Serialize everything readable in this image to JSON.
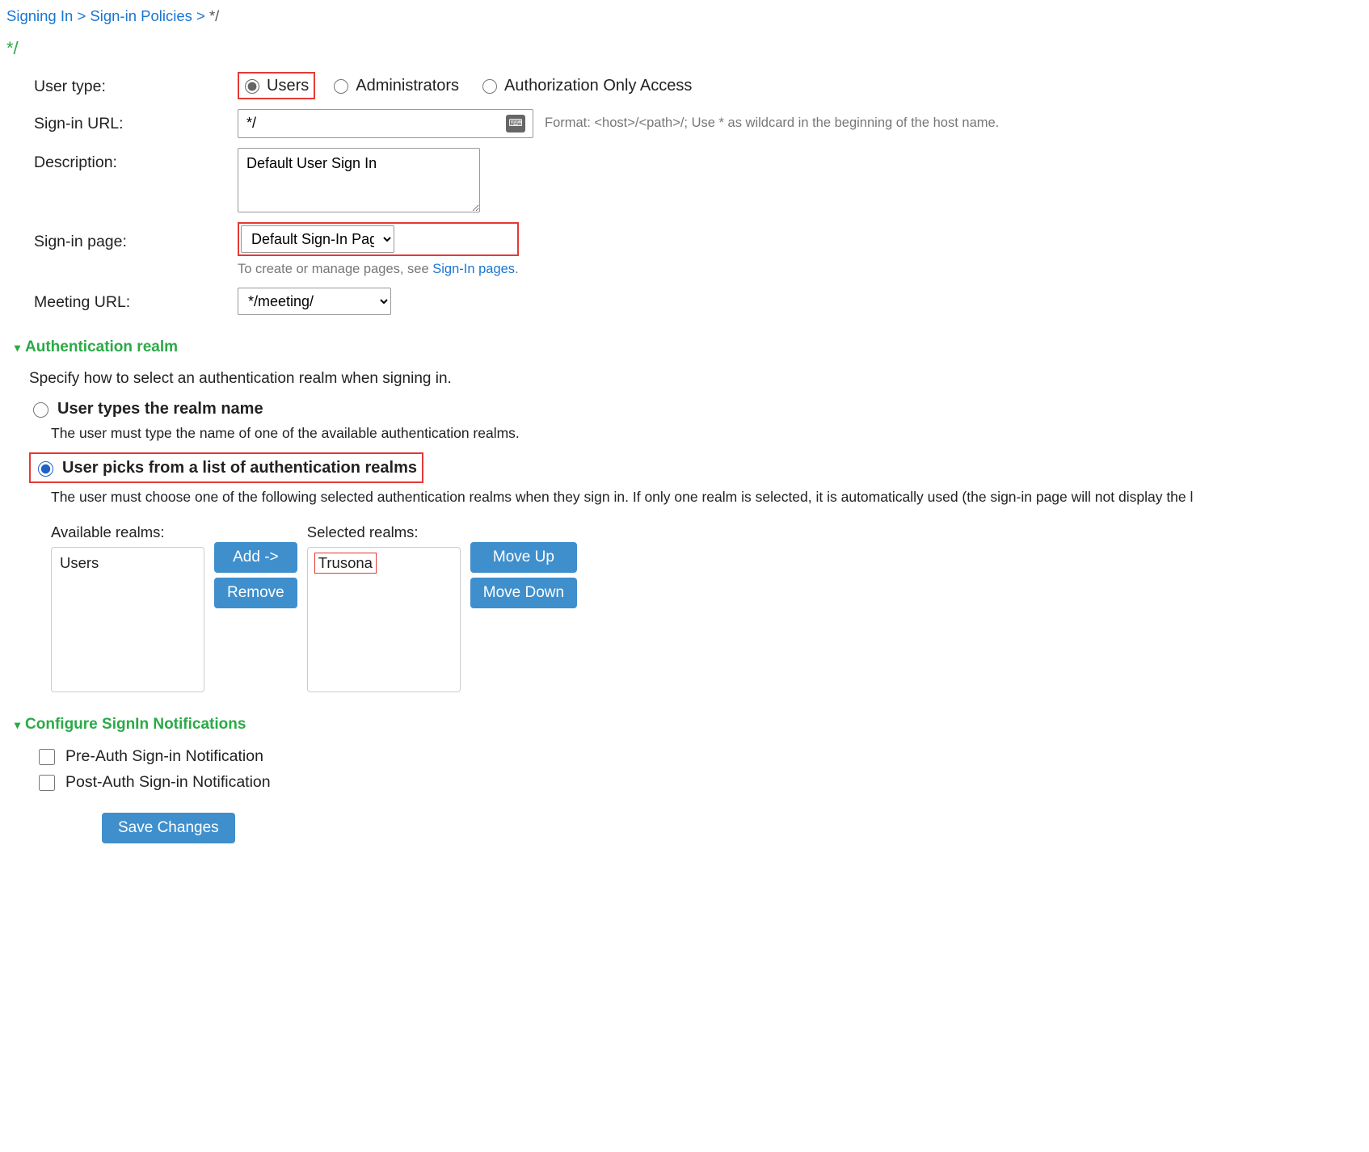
{
  "breadcrumb": {
    "items": [
      "Signing In",
      "Sign-in Policies"
    ],
    "leaf": "*/"
  },
  "title": "*/",
  "form": {
    "user_type_label": "User type:",
    "user_type_options": {
      "users": "Users",
      "administrators": "Administrators",
      "auth_only": "Authorization Only Access"
    },
    "sign_in_url_label": "Sign-in URL:",
    "sign_in_url_value": "*/",
    "sign_in_url_format": "Format: <host>/<path>/;   Use * as wildcard in the beginning of the host name.",
    "description_label": "Description:",
    "description_value": "Default User Sign In",
    "sign_in_page_label": "Sign-in page:",
    "sign_in_page_value": "Default Sign-In Page",
    "sign_in_page_hint_prefix": "To create or manage pages, see ",
    "sign_in_page_hint_link": "Sign-In pages",
    "sign_in_page_hint_suffix": ".",
    "meeting_url_label": "Meeting URL:",
    "meeting_url_value": "*/meeting/"
  },
  "section_auth": {
    "header": "Authentication realm",
    "intro": "Specify how to select an authentication realm when signing in.",
    "opt_types_name": {
      "title": "User types the realm name",
      "desc": "The user must type the name of one of the available authentication realms."
    },
    "opt_picks_list": {
      "title": "User picks from a list of authentication realms",
      "desc": "The user must choose one of the following selected authentication realms when they sign in. If only one realm is selected, it is automatically used (the sign-in page will not display the l"
    },
    "available_label": "Available realms:",
    "selected_label": "Selected realms:",
    "available_items": [
      "Users"
    ],
    "selected_items": [
      "Trusona"
    ],
    "btn_add": "Add ->",
    "btn_remove": "Remove",
    "btn_up": "Move Up",
    "btn_down": "Move Down"
  },
  "section_notify": {
    "header": "Configure SignIn Notifications",
    "pre_auth": "Pre-Auth Sign-in Notification",
    "post_auth": "Post-Auth Sign-in Notification"
  },
  "save_label": "Save Changes"
}
